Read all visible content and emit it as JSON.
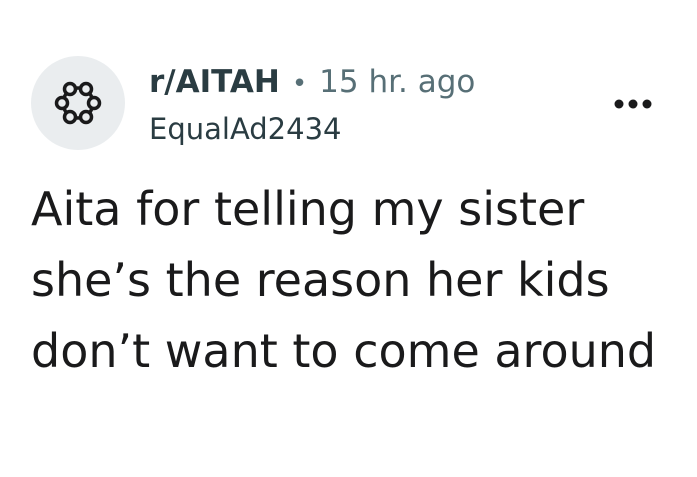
{
  "post": {
    "subreddit": "r/AITAH",
    "separator": "•",
    "time_ago": "15 hr. ago",
    "author": "EqualAd2434",
    "title": "Aita for telling my sister she’s the reason her kids don’t want to come around"
  },
  "icons": {
    "avatar": "subreddit-ring-icon",
    "more": "more-options-icon"
  },
  "colors": {
    "background": "#ffffff",
    "avatar_background": "#eaedef",
    "text_primary": "#1a1a1b",
    "text_secondary": "#576f76"
  }
}
